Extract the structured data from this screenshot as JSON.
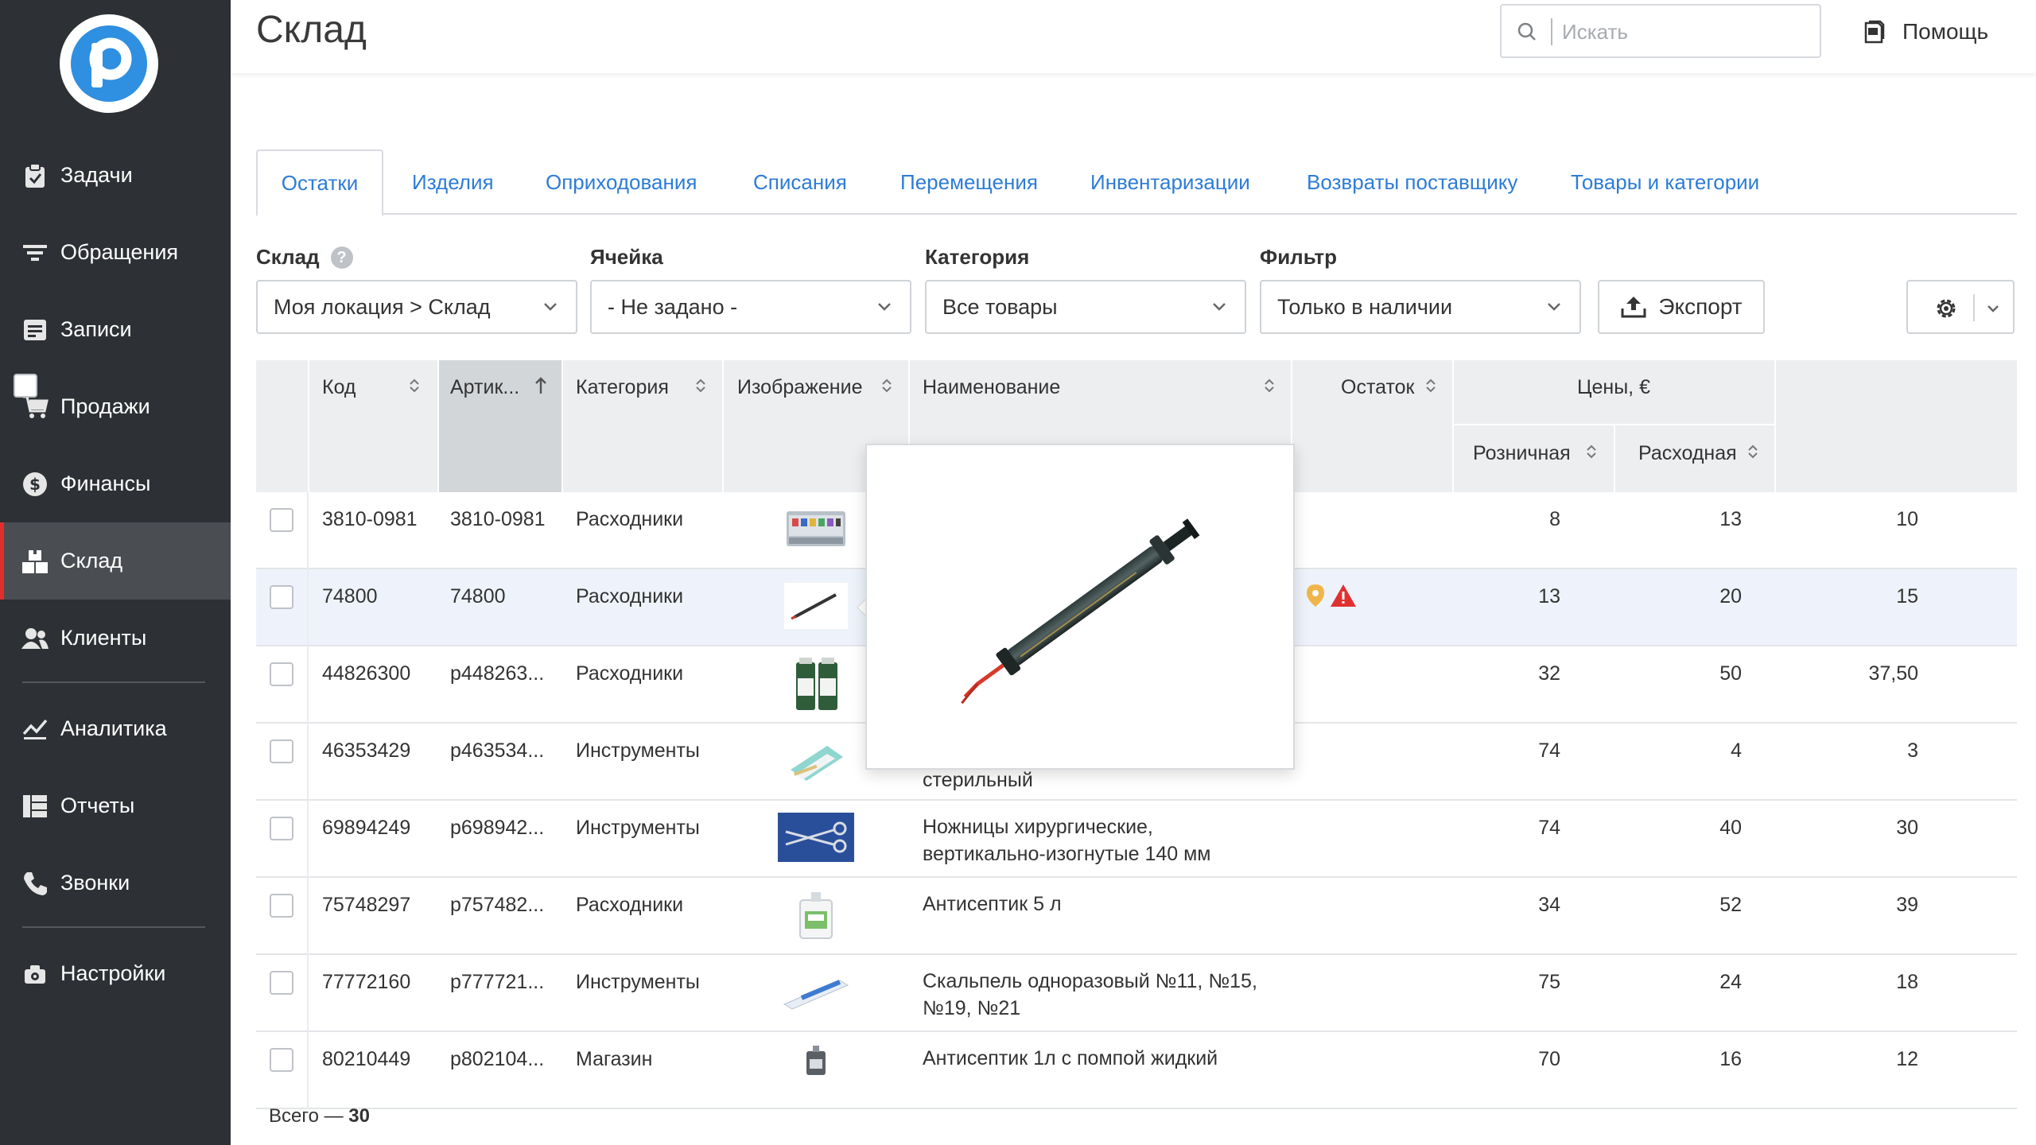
{
  "app": {
    "page_title": "Склад",
    "search_placeholder": "Искать",
    "help_label": "Помощь"
  },
  "sidebar": {
    "items": [
      {
        "label": "Задачи",
        "icon": "clipboard-icon"
      },
      {
        "label": "Обращения",
        "icon": "filter-icon"
      },
      {
        "label": "Записи",
        "icon": "notes-icon"
      },
      {
        "label": "Продажи",
        "icon": "cart-icon"
      },
      {
        "label": "Финансы",
        "icon": "dollar-icon"
      },
      {
        "label": "Склад",
        "icon": "boxes-icon",
        "active": true
      },
      {
        "label": "Клиенты",
        "icon": "users-icon"
      },
      {
        "label": "Аналитика",
        "icon": "chart-icon"
      },
      {
        "label": "Отчеты",
        "icon": "grid-icon"
      },
      {
        "label": "Звонки",
        "icon": "phone-icon"
      },
      {
        "label": "Настройки",
        "icon": "camera-gear-icon"
      }
    ]
  },
  "tabs": [
    {
      "label": "Остатки",
      "active": true
    },
    {
      "label": "Изделия"
    },
    {
      "label": "Оприходования"
    },
    {
      "label": "Списания"
    },
    {
      "label": "Перемещения"
    },
    {
      "label": "Инвентаризации"
    },
    {
      "label": "Возвраты поставщику"
    },
    {
      "label": "Товары и категории"
    }
  ],
  "filters": {
    "warehouse_label": "Склад",
    "warehouse_value": "Моя локация > Склад",
    "cell_label": "Ячейка",
    "cell_value": "- Не задано -",
    "category_label": "Категория",
    "category_value": "Все товары",
    "filter_label": "Фильтр",
    "filter_value": "Только в наличии",
    "export_label": "Экспорт",
    "help_mark": "?"
  },
  "table": {
    "headers": {
      "code": "Код",
      "article": "Артик...",
      "category": "Категория",
      "image": "Изображение",
      "name": "Наименование",
      "stock": "Остаток",
      "prices": "Цены, €",
      "retail": "Розничная",
      "expense": "Расходная"
    },
    "rows": [
      {
        "code": "3810-0981",
        "article": "3810-0981",
        "category": "Расходники",
        "name1": "",
        "name2": "",
        "stock": "8",
        "retail": "13",
        "expense": "10"
      },
      {
        "code": "74800",
        "article": "74800",
        "category": "Расходники",
        "name1": "",
        "name2": "",
        "stock": "13",
        "retail": "20",
        "expense": "15"
      },
      {
        "code": "44826300",
        "article": "p448263...",
        "category": "Расходники",
        "name1": "",
        "name2": "",
        "stock": "32",
        "retail": "50",
        "expense": "37,50"
      },
      {
        "code": "46353429",
        "article": "p463534...",
        "category": "Инструменты",
        "name1": "",
        "name2": "стерильный",
        "stock": "74",
        "retail": "4",
        "expense": "3"
      },
      {
        "code": "69894249",
        "article": "p698942...",
        "category": "Инструменты",
        "name1": "Ножницы хирургические,",
        "name2": "вертикально-изогнутые 140 мм",
        "stock": "74",
        "retail": "40",
        "expense": "30"
      },
      {
        "code": "75748297",
        "article": "p757482...",
        "category": "Расходники",
        "name1": "Антисептик 5 л",
        "name2": "",
        "stock": "34",
        "retail": "52",
        "expense": "39"
      },
      {
        "code": "77772160",
        "article": "p777721...",
        "category": "Инструменты",
        "name1": "Скальпель одноразовый №11, №15,",
        "name2": "№19, №21",
        "stock": "75",
        "retail": "24",
        "expense": "18"
      },
      {
        "code": "80210449",
        "article": "p802104...",
        "category": "Магазин",
        "name1": "Антисептик 1л с помпой жидкий",
        "name2": "",
        "stock": "70",
        "retail": "16",
        "expense": "12"
      }
    ],
    "total_prefix": "Всего — ",
    "total_count": "30"
  },
  "colors": {
    "sidebar_bg": "#2d3034",
    "accent_blue": "#2d7cd6",
    "active_marker": "#e32d2d",
    "logo_blue": "#2f8fe0"
  }
}
